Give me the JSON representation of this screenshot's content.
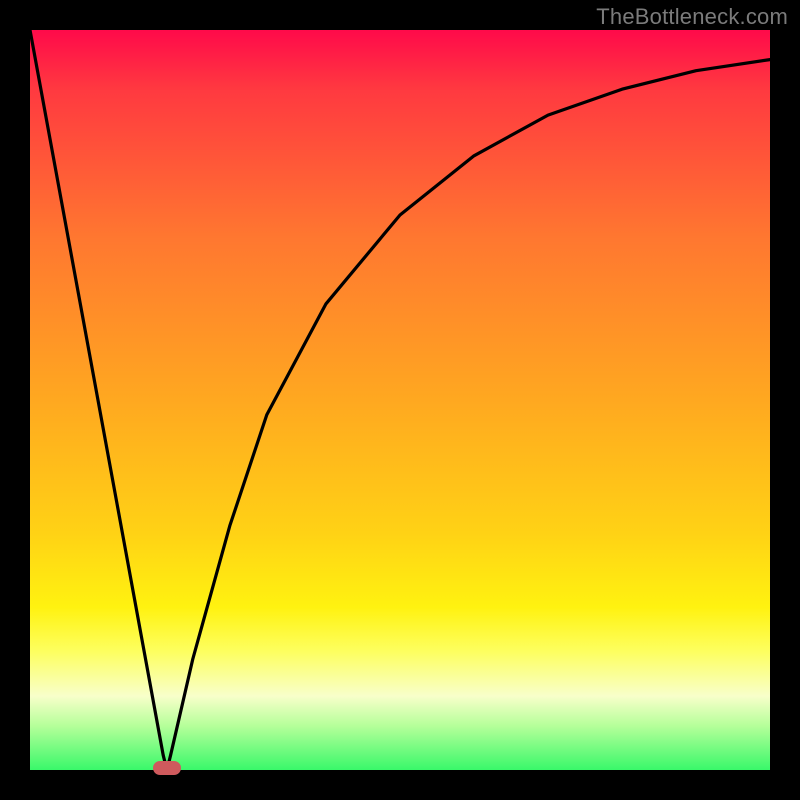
{
  "watermark": "TheBottleneck.com",
  "chart_data": {
    "type": "line",
    "title": "",
    "xlabel": "",
    "ylabel": "",
    "xlim": [
      0,
      1
    ],
    "ylim": [
      0,
      1
    ],
    "series": [
      {
        "name": "curve",
        "x": [
          0.0,
          0.18,
          0.185,
          0.19,
          0.22,
          0.27,
          0.32,
          0.4,
          0.5,
          0.6,
          0.7,
          0.8,
          0.9,
          1.0
        ],
        "values": [
          1.0,
          0.02,
          0.0,
          0.02,
          0.15,
          0.33,
          0.48,
          0.63,
          0.75,
          0.83,
          0.885,
          0.92,
          0.945,
          0.96
        ]
      }
    ],
    "annotations": [
      {
        "type": "marker",
        "shape": "pill",
        "x": 0.185,
        "y": 0.003,
        "color": "#cf5a5d"
      }
    ],
    "background_gradient": {
      "orientation": "vertical",
      "stops": [
        {
          "pos": 0.0,
          "color": "#ff0a4a"
        },
        {
          "pos": 0.08,
          "color": "#ff3940"
        },
        {
          "pos": 0.28,
          "color": "#ff7730"
        },
        {
          "pos": 0.5,
          "color": "#ffa820"
        },
        {
          "pos": 0.68,
          "color": "#ffd215"
        },
        {
          "pos": 0.78,
          "color": "#fff210"
        },
        {
          "pos": 0.84,
          "color": "#fdff60"
        },
        {
          "pos": 0.9,
          "color": "#f8ffca"
        },
        {
          "pos": 0.94,
          "color": "#b6ff9a"
        },
        {
          "pos": 1.0,
          "color": "#39f86a"
        }
      ]
    }
  }
}
